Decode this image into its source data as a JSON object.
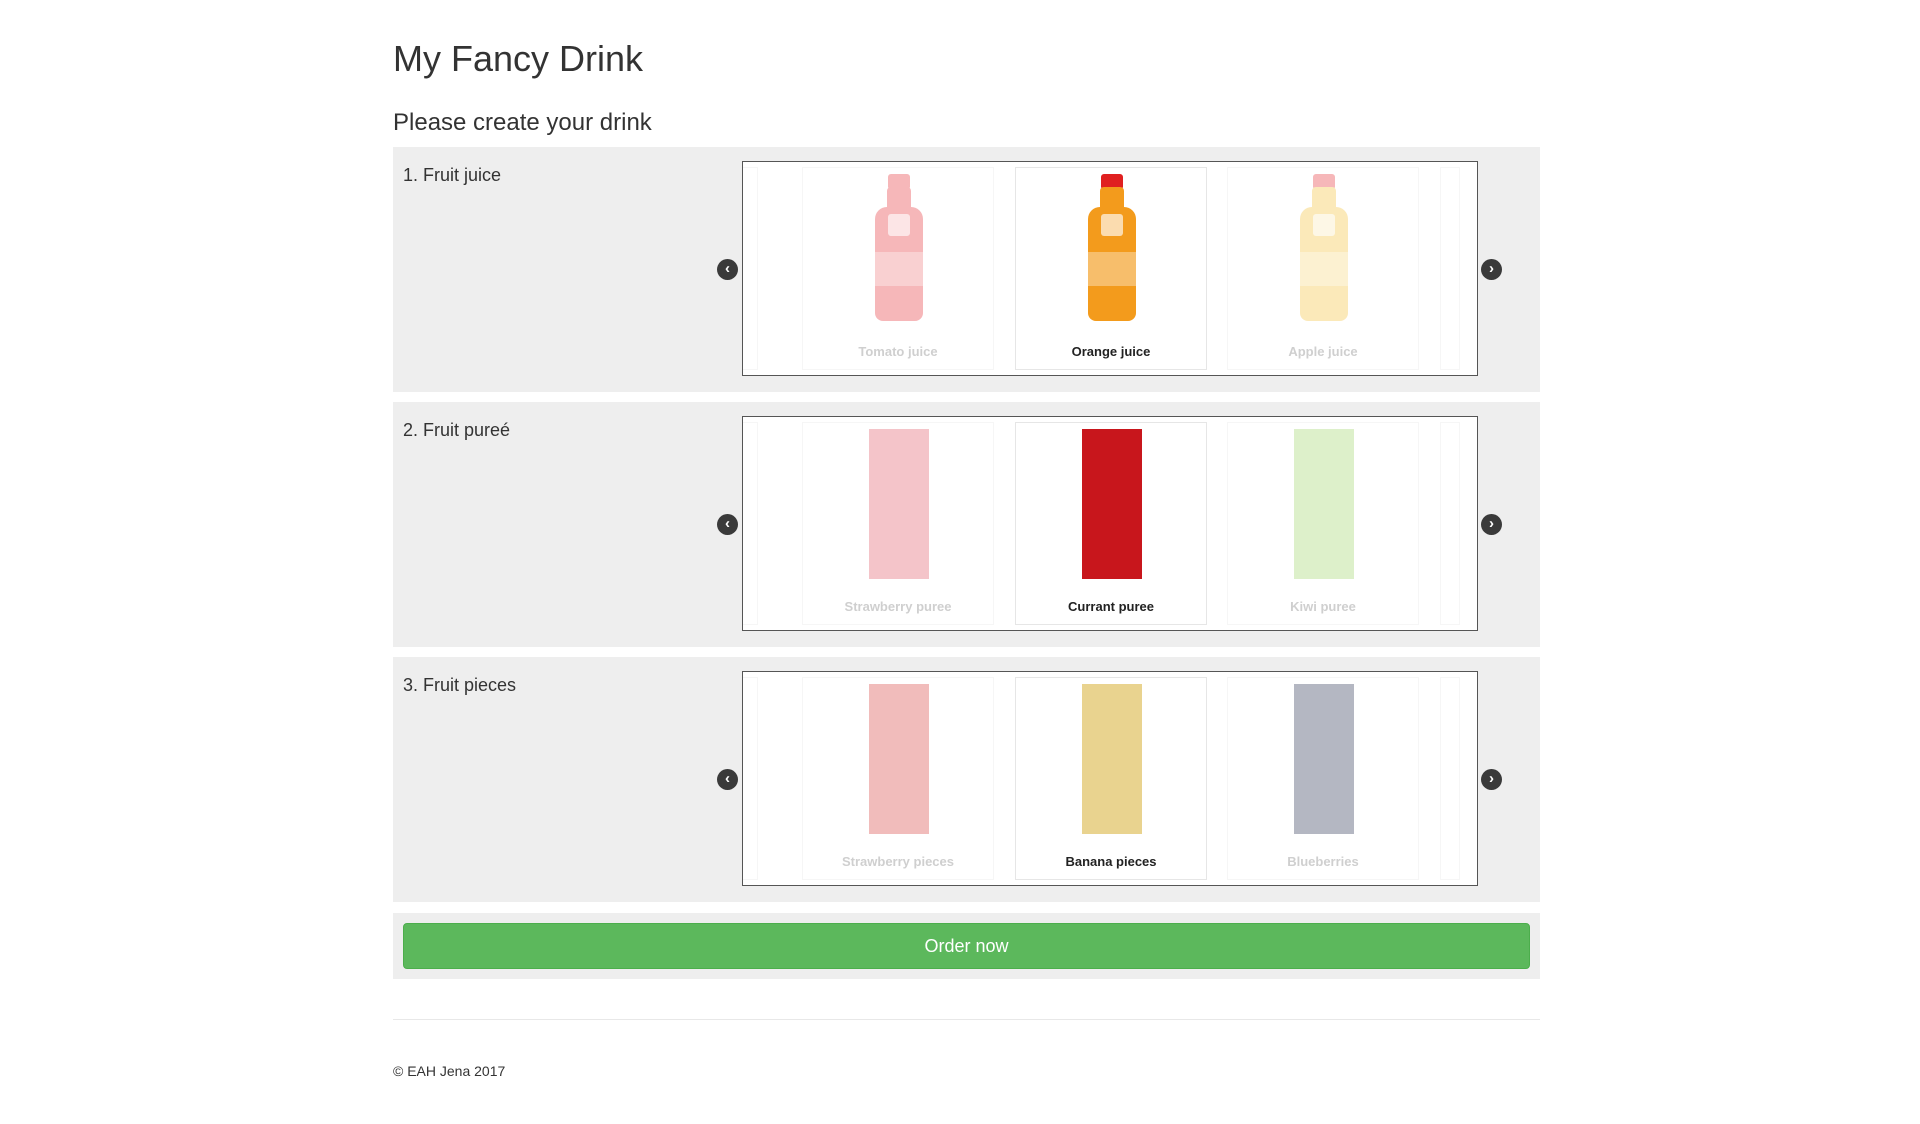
{
  "page": {
    "title": "My Fancy Drink",
    "subtitle": "Please create your drink"
  },
  "sections": [
    {
      "label": "1. Fruit juice",
      "prev_icon": "chevron-left-icon",
      "next_icon": "chevron-right-icon",
      "items": [
        {
          "caption": "Tomato juice",
          "selected": false,
          "visual": "bottle",
          "color": "#e8333a",
          "cap_color": "#e8333a"
        },
        {
          "caption": "Orange juice",
          "selected": true,
          "visual": "bottle",
          "color": "#f39b1c",
          "cap_color": "#e02020"
        },
        {
          "caption": "Apple juice",
          "selected": false,
          "visual": "bottle",
          "color": "#f6c33a",
          "cap_color": "#e8333a"
        }
      ]
    },
    {
      "label": "2. Fruit pureé",
      "prev_icon": "chevron-left-icon",
      "next_icon": "chevron-right-icon",
      "items": [
        {
          "caption": "Strawberry puree",
          "selected": false,
          "visual": "tile",
          "color": "#e05a68"
        },
        {
          "caption": "Currant puree",
          "selected": true,
          "visual": "tile",
          "color": "#c8161c"
        },
        {
          "caption": "Kiwi puree",
          "selected": false,
          "visual": "tile",
          "color": "#9fd56a"
        }
      ]
    },
    {
      "label": "3. Fruit pieces",
      "prev_icon": "chevron-left-icon",
      "next_icon": "chevron-right-icon",
      "items": [
        {
          "caption": "Strawberry pieces",
          "selected": false,
          "visual": "tile",
          "color": "#d9413f"
        },
        {
          "caption": "Banana pieces",
          "selected": true,
          "visual": "tile",
          "color": "#e9d38f"
        },
        {
          "caption": "Blueberries",
          "selected": false,
          "visual": "tile",
          "color": "#2b3552"
        }
      ]
    }
  ],
  "order": {
    "button_label": "Order now",
    "button_color": "#5cb85c"
  },
  "footer": {
    "text": "© EAH Jena 2017"
  }
}
